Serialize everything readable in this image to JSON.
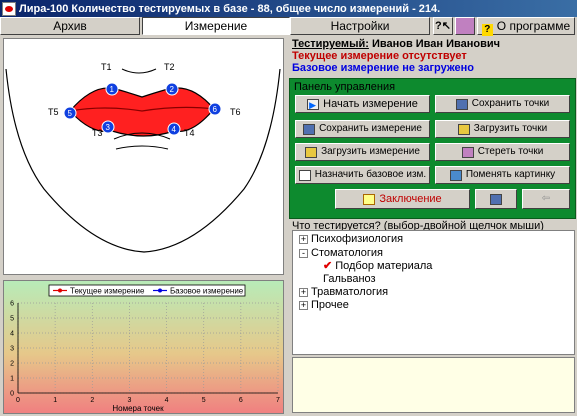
{
  "window": {
    "title": "Лира-100   Количество тестируемых в базе - 88, общее число измерений - 214."
  },
  "tabs": [
    {
      "label": "Архив"
    },
    {
      "label": "Измерение"
    },
    {
      "label": "Настройки"
    }
  ],
  "toolbar": {
    "help_icon": "help-pointer-icon",
    "book_icon": "book-icon",
    "about_label": "О программе"
  },
  "subject": {
    "label": "Тестируемый:",
    "name": "Иванов Иван Иванович",
    "current_status": "Текущее измерение отсутствует",
    "base_status": "Базовое измерение не загружено"
  },
  "control_panel": {
    "title": "Панель управления",
    "buttons": {
      "start": "Начать измерение",
      "save_points": "Сохранить точки",
      "save_measure": "Сохранить измерение",
      "load_points": "Загрузить точки",
      "load_measure": "Загрузить измерение",
      "erase_points": "Стереть точки",
      "set_base": "Назначить базовое изм.",
      "change_picture": "Поменять картинку",
      "conclusion": "Заключение"
    }
  },
  "face": {
    "point_labels": [
      "T1",
      "T2",
      "T3",
      "T4",
      "T5",
      "T6"
    ],
    "point_numbers": [
      "1",
      "2",
      "3",
      "4",
      "5",
      "6"
    ]
  },
  "tree": {
    "title": "Что тестируется? (выбор-двойной щелчок мыши)",
    "items": [
      {
        "label": "Психофизиология",
        "expander": "+"
      },
      {
        "label": "Стоматология",
        "expander": "-"
      },
      {
        "label": "Подбор материала"
      },
      {
        "label": "Гальваноз"
      },
      {
        "label": "Травматология",
        "expander": "+"
      },
      {
        "label": "Прочее",
        "expander": "+"
      }
    ]
  },
  "chart_data": {
    "type": "line",
    "title": "",
    "xlabel": "Номера точек",
    "ylabel": "",
    "xlim": [
      0,
      7
    ],
    "ylim": [
      0,
      6
    ],
    "x_ticks": [
      "0",
      "1",
      "2",
      "3",
      "4",
      "5",
      "6",
      "7"
    ],
    "y_ticks": [
      "0",
      "1",
      "2",
      "3",
      "4",
      "5",
      "6"
    ],
    "grid": true,
    "legend_position": "top",
    "series": [
      {
        "name": "Текущее измерение",
        "color": "#e00000",
        "values": []
      },
      {
        "name": "Базовое измерение",
        "color": "#0000e0",
        "values": []
      }
    ]
  },
  "colors": {
    "accent_green": "#0d8a2e",
    "status_red": "#c00000",
    "status_blue": "#0000e0",
    "lip_red": "#ff2020",
    "point_blue": "#1040e0"
  }
}
